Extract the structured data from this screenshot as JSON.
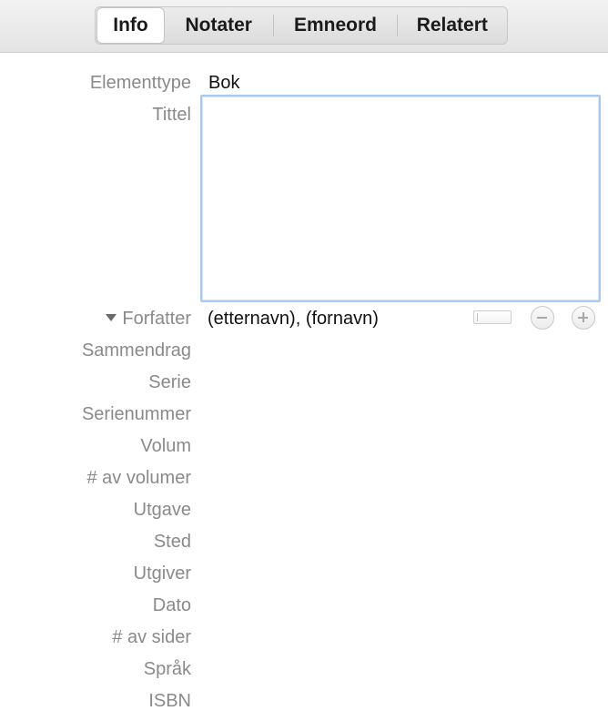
{
  "tabs": [
    {
      "label": "Info",
      "active": true
    },
    {
      "label": "Notater",
      "active": false
    },
    {
      "label": "Emneord",
      "active": false
    },
    {
      "label": "Relatert",
      "active": false
    }
  ],
  "fields": {
    "item_type": {
      "label": "Elementtype",
      "value": "Bok"
    },
    "title": {
      "label": "Tittel",
      "value": ""
    },
    "author": {
      "label": "Forfatter",
      "value": "(etternavn), (fornavn)"
    },
    "abstract": {
      "label": "Sammendrag"
    },
    "series": {
      "label": "Serie"
    },
    "series_number": {
      "label": "Serienummer"
    },
    "volume": {
      "label": "Volum"
    },
    "num_volumes": {
      "label": "# av volumer"
    },
    "edition": {
      "label": "Utgave"
    },
    "place": {
      "label": "Sted"
    },
    "publisher": {
      "label": "Utgiver"
    },
    "date": {
      "label": "Dato"
    },
    "num_pages": {
      "label": "# av sider"
    },
    "language": {
      "label": "Språk"
    },
    "isbn": {
      "label": "ISBN"
    }
  },
  "icons": {
    "remove_author": "minus-circle-icon",
    "add_author": "plus-circle-icon",
    "disclosure": "triangle-down-icon"
  },
  "colors": {
    "label": "#8a8a8a",
    "focus_ring": "#a9c8ec"
  }
}
